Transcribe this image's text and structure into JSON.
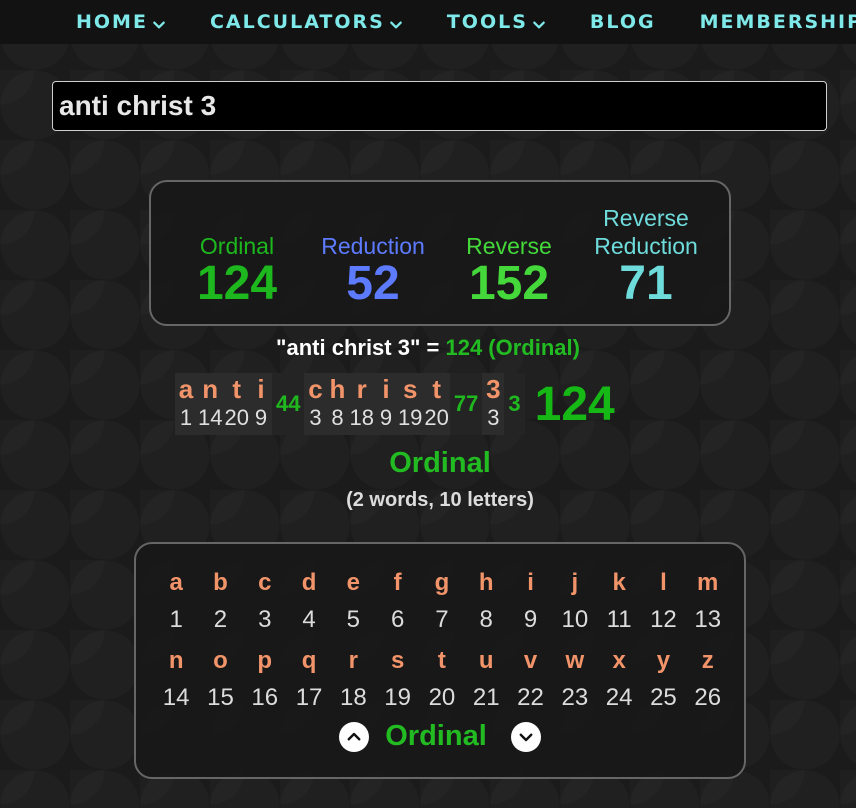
{
  "nav": {
    "items": [
      {
        "label": "HOME",
        "dropdown": true
      },
      {
        "label": "CALCULATORS",
        "dropdown": true
      },
      {
        "label": "TOOLS",
        "dropdown": true
      },
      {
        "label": "BLOG",
        "dropdown": false
      },
      {
        "label": "MEMBERSHIP",
        "dropdown": false
      }
    ]
  },
  "search": {
    "value": "anti christ 3"
  },
  "summary": {
    "ciphers": [
      {
        "name_line1": "",
        "name_line2": "Ordinal",
        "value": "124",
        "color": "#1db81d"
      },
      {
        "name_line1": "",
        "name_line2": "Reduction",
        "value": "52",
        "color": "#5d7bff"
      },
      {
        "name_line1": "",
        "name_line2": "Reverse",
        "value": "152",
        "color": "#44d83a"
      },
      {
        "name_line1": "Reverse",
        "name_line2": "Reduction",
        "value": "71",
        "color": "#6fdcdc"
      }
    ]
  },
  "equation": {
    "phrase": "\"anti christ 3\" = ",
    "result": "124 (Ordinal)"
  },
  "breakdown": {
    "words": [
      {
        "letters": [
          {
            "ch": "a",
            "num": "1"
          },
          {
            "ch": "n",
            "num": "14"
          },
          {
            "ch": "t",
            "num": "20"
          },
          {
            "ch": "i",
            "num": "9"
          }
        ],
        "sum": "44"
      },
      {
        "letters": [
          {
            "ch": "c",
            "num": "3"
          },
          {
            "ch": "h",
            "num": "8"
          },
          {
            "ch": "r",
            "num": "18"
          },
          {
            "ch": "i",
            "num": "9"
          },
          {
            "ch": "s",
            "num": "19"
          },
          {
            "ch": "t",
            "num": "20"
          }
        ],
        "sum": "77"
      },
      {
        "letters": [
          {
            "ch": "3",
            "num": "3"
          }
        ],
        "sum": "3"
      }
    ],
    "total": "124"
  },
  "cipher_title": "Ordinal",
  "counts": "(2 words, 10 letters)",
  "chart": {
    "rows": [
      [
        {
          "ch": "a",
          "num": "1"
        },
        {
          "ch": "b",
          "num": "2"
        },
        {
          "ch": "c",
          "num": "3"
        },
        {
          "ch": "d",
          "num": "4"
        },
        {
          "ch": "e",
          "num": "5"
        },
        {
          "ch": "f",
          "num": "6"
        },
        {
          "ch": "g",
          "num": "7"
        },
        {
          "ch": "h",
          "num": "8"
        },
        {
          "ch": "i",
          "num": "9"
        },
        {
          "ch": "j",
          "num": "10"
        },
        {
          "ch": "k",
          "num": "11"
        },
        {
          "ch": "l",
          "num": "12"
        },
        {
          "ch": "m",
          "num": "13"
        }
      ],
      [
        {
          "ch": "n",
          "num": "14"
        },
        {
          "ch": "o",
          "num": "15"
        },
        {
          "ch": "p",
          "num": "16"
        },
        {
          "ch": "q",
          "num": "17"
        },
        {
          "ch": "r",
          "num": "18"
        },
        {
          "ch": "s",
          "num": "19"
        },
        {
          "ch": "t",
          "num": "20"
        },
        {
          "ch": "u",
          "num": "21"
        },
        {
          "ch": "v",
          "num": "22"
        },
        {
          "ch": "w",
          "num": "23"
        },
        {
          "ch": "x",
          "num": "24"
        },
        {
          "ch": "y",
          "num": "25"
        },
        {
          "ch": "z",
          "num": "26"
        }
      ]
    ],
    "cipher_name": "Ordinal",
    "prev_icon": "chevron-up-icon",
    "next_icon": "chevron-down-icon"
  }
}
